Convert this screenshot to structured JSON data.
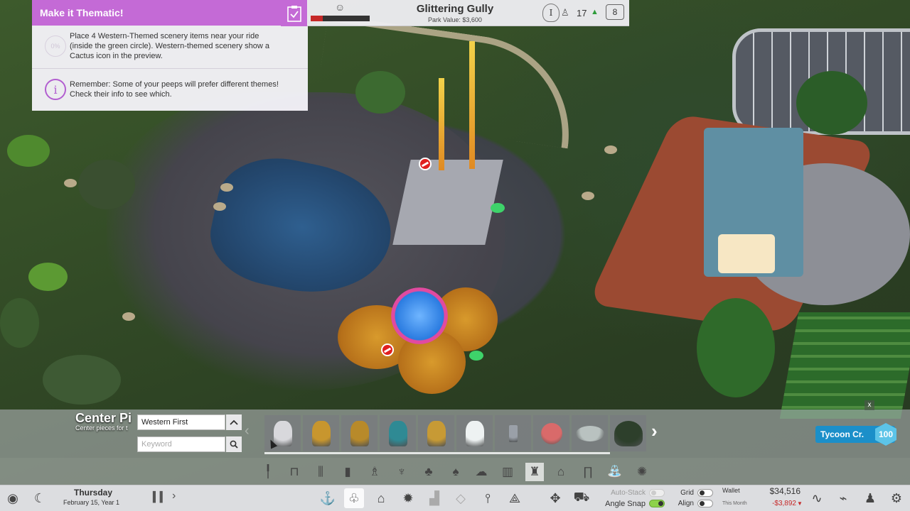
{
  "objective": {
    "title": "Make it Thematic!",
    "progress": "0%",
    "task": "Place 4 Western-Themed scenery items near your ride (inside the green circle). Western-themed scenery show a Cactus icon in the preview.",
    "info_glyph": "i",
    "reminder": "Remember: Some of your peeps will prefer different themes!  Check their info to see which.",
    "accent_color": "#c46ad6"
  },
  "topbar": {
    "happiness_fraction": 0.2,
    "park_name": "Glittering Gully",
    "park_value": "Park Value: $3,600",
    "rank": "I",
    "peep_count": "17",
    "trend": "▲",
    "messages": "8"
  },
  "drawer": {
    "category_title": "Center Pi",
    "category_subtitle": "Center pieces for t",
    "sort_value": "Western First",
    "keyword_placeholder": "Keyword",
    "close_glyph": "x",
    "items": [
      {
        "name": "bunny-statue",
        "color": "#d8d8dc"
      },
      {
        "name": "gold-figure-statue",
        "color": "#c8962e"
      },
      {
        "name": "gold-trophy-statue",
        "color": "#b88a2a"
      },
      {
        "name": "teal-gold-statue",
        "color": "#2f8a94"
      },
      {
        "name": "gold-rider-statue",
        "color": "#c79a35"
      },
      {
        "name": "white-swan-statue",
        "color": "#eef2f2"
      },
      {
        "name": "metal-pillar",
        "color": "#9aa0a8"
      },
      {
        "name": "snow-globe",
        "color": "#d96a6a"
      },
      {
        "name": "stone-fountain",
        "color": "#b9c2c0"
      },
      {
        "name": "dark-tree",
        "color": "#2d3f2b"
      }
    ],
    "tycoon_label": "Tycoon Cr.",
    "tycoon_value": "100"
  },
  "bottombar": {
    "day": "Thursday",
    "date": "February 15,   Year 1",
    "auto_stack": "Auto-Stack",
    "angle_snap": "Angle Snap",
    "grid": "Grid",
    "align": "Align",
    "wallet_label": "Wallet",
    "wallet_value": "$34,516",
    "month_label": "This Month",
    "month_value": "-$3,892"
  }
}
